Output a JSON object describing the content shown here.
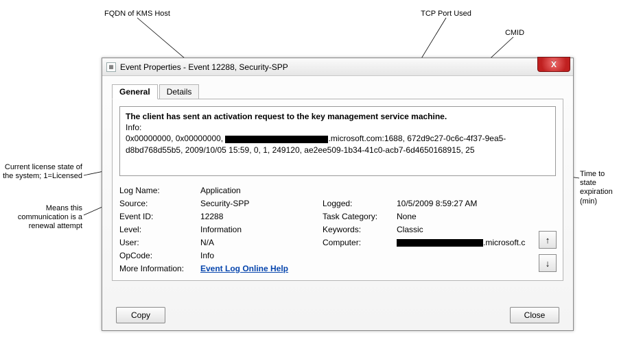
{
  "annotations": {
    "fqdn": "FQDN of KMS Host",
    "tcp_port": "TCP Port Used",
    "cmid": "CMID",
    "license_state": "Current license state of the system; 1=Licensed",
    "renewal": "Means this communication is a renewal attempt",
    "expiration": "Time to state expiration (min)"
  },
  "titlebar": {
    "title": "Event Properties - Event 12288, Security-SPP",
    "close_x": "X"
  },
  "tabs": {
    "general": "General",
    "details": "Details"
  },
  "description": {
    "subject": "The client has sent an activation request to the key management service machine.",
    "info_label": "Info:",
    "prefix": "0x00000000, 0x00000000, ",
    "fqdn_suffix": ".microsoft.com",
    "port_sep": ":",
    "port": "1688",
    "cmid": "672d9c27-0c6c-4f37-9ea5-d8bd768d55b5",
    "timestamp": "2009/10/05 15:59",
    "renewal_flag": "0",
    "license_state_flag": "1",
    "expiration_min": "249120",
    "aid": "ae2ee509-1b34-41c0-acb7-6d4650168915",
    "trailing": "25"
  },
  "fields": {
    "log_name_lab": "Log Name:",
    "log_name": "Application",
    "source_lab": "Source:",
    "source": "Security-SPP",
    "logged_lab": "Logged:",
    "logged": "10/5/2009 8:59:27 AM",
    "event_id_lab": "Event ID:",
    "event_id": "12288",
    "task_cat_lab": "Task Category:",
    "task_cat": "None",
    "level_lab": "Level:",
    "level": "Information",
    "keywords_lab": "Keywords:",
    "keywords": "Classic",
    "user_lab": "User:",
    "user": "N/A",
    "computer_lab": "Computer:",
    "computer_suffix": ".microsoft.c",
    "opcode_lab": "OpCode:",
    "opcode": "Info",
    "more_info_lab": "More Information:",
    "more_info_link": "Event Log Online Help"
  },
  "buttons": {
    "copy": "Copy",
    "close": "Close",
    "up": "↑",
    "down": "↓"
  }
}
